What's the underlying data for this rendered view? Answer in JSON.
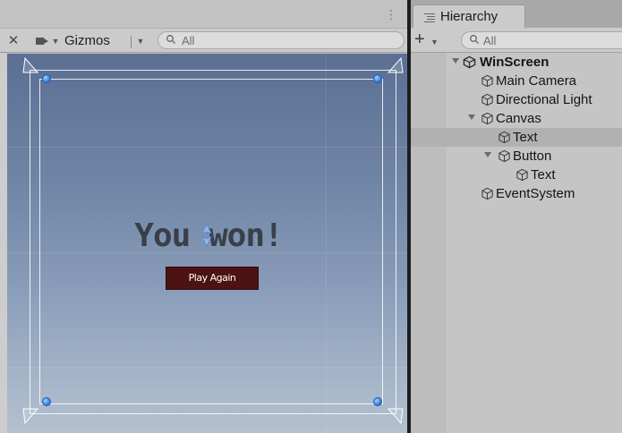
{
  "scene": {
    "toolbar": {
      "gizmos_label": "Gizmos",
      "search_placeholder": "All"
    },
    "game_ui": {
      "title_text": "You won!",
      "button_label": "Play Again",
      "title_color": "#3a3e47",
      "button_color": "#4d1212"
    }
  },
  "hierarchy": {
    "tab_label": "Hierarchy",
    "search_placeholder": "All",
    "items": [
      {
        "label": "WinScreen",
        "bold": true,
        "expanded": true,
        "icon": "unity-scene-icon"
      },
      {
        "label": "Main Camera",
        "icon": "gameobject-cube-icon"
      },
      {
        "label": "Directional Light",
        "icon": "gameobject-cube-icon"
      },
      {
        "label": "Canvas",
        "expanded": true,
        "icon": "gameobject-cube-icon"
      },
      {
        "label": "Text",
        "selected": true,
        "icon": "gameobject-cube-icon"
      },
      {
        "label": "Button",
        "expanded": true,
        "icon": "gameobject-cube-icon"
      },
      {
        "label": "Text",
        "icon": "gameobject-cube-icon"
      },
      {
        "label": "EventSystem",
        "icon": "gameobject-cube-icon"
      }
    ]
  }
}
